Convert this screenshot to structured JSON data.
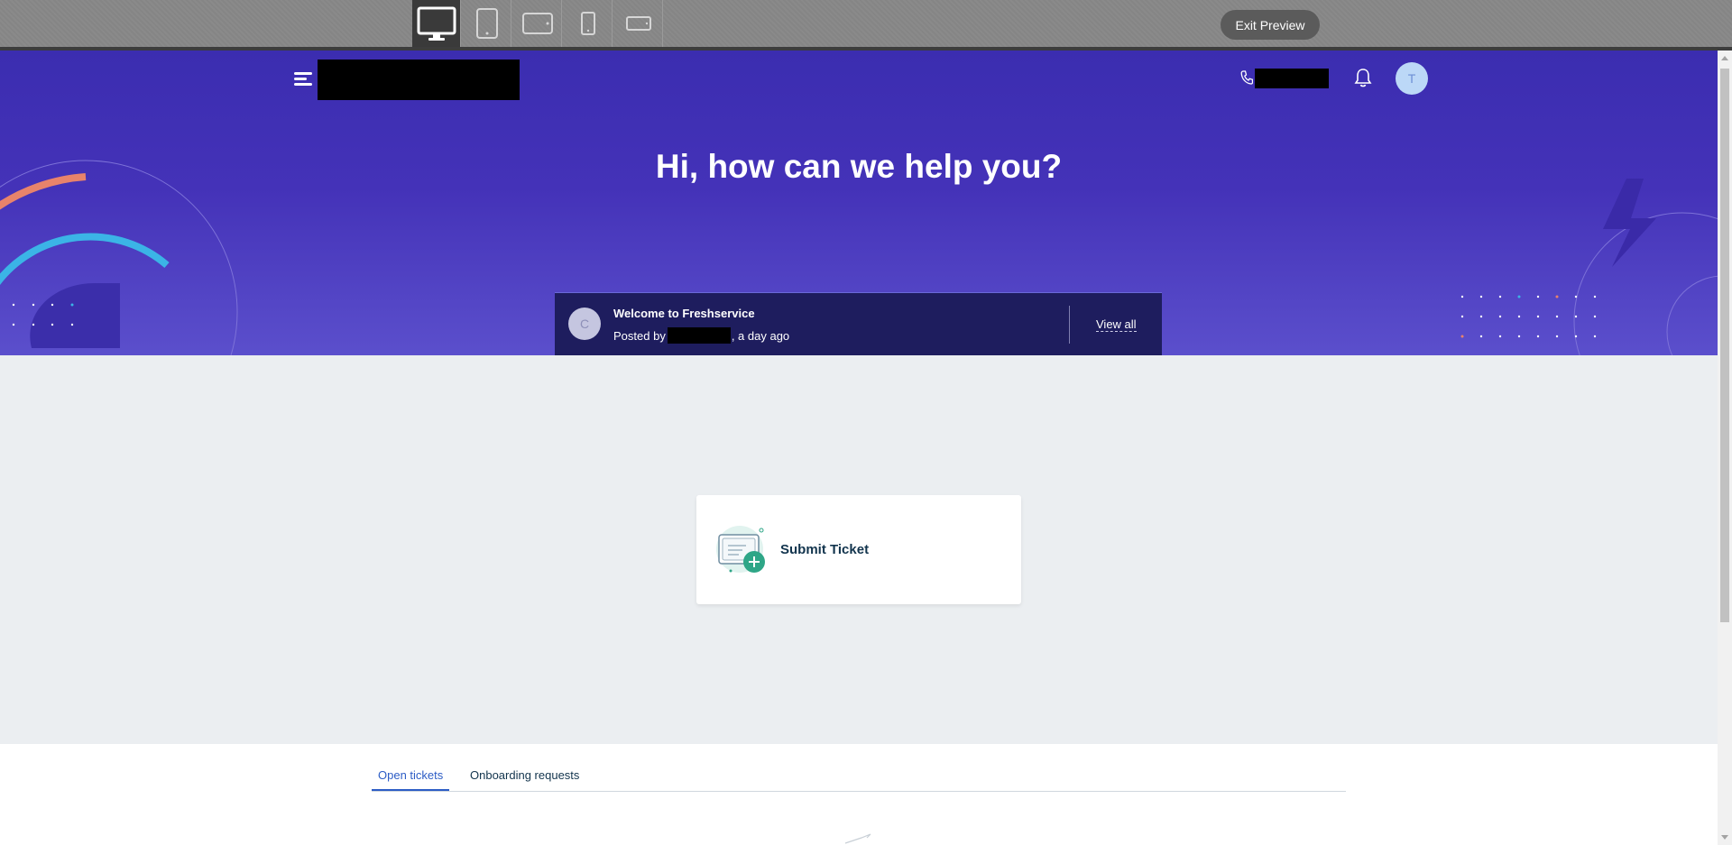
{
  "preview": {
    "devices": [
      {
        "icon": "desktop-icon",
        "active": true
      },
      {
        "icon": "tablet-portrait-icon",
        "active": false
      },
      {
        "icon": "tablet-landscape-icon",
        "active": false
      },
      {
        "icon": "mobile-portrait-icon",
        "active": false
      },
      {
        "icon": "mobile-landscape-icon",
        "active": false
      }
    ],
    "exit_label": "Exit Preview"
  },
  "header": {
    "avatar_initial": "T",
    "title": "Hi, how can we help you?"
  },
  "announcement": {
    "avatar_initial": "C",
    "title": "Welcome to Freshservice",
    "posted_by_prefix": "Posted by",
    "posted_suffix": ", a day ago",
    "view_all_label": "View all"
  },
  "actions": {
    "submit_ticket_label": "Submit Ticket"
  },
  "tabs": [
    {
      "label": "Open tickets",
      "active": true
    },
    {
      "label": "Onboarding requests",
      "active": false
    }
  ],
  "colors": {
    "hero_top": "#3b2db0",
    "hero_bottom": "#5b4fcc",
    "announcement_bg": "#1e1d5e",
    "active_tab": "#2c5cc5",
    "accent_orange": "#e8836b",
    "accent_cyan": "#3bb4e6"
  }
}
